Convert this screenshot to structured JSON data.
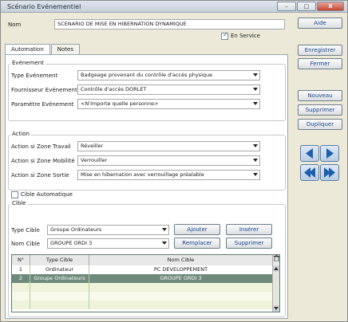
{
  "window": {
    "title": "Scénario Evénementiel",
    "controls": [
      "–",
      "□",
      "X"
    ]
  },
  "header": {
    "name_label": "Nom",
    "name_value": "SCENARIO DE MISE EN HIBERNATION DYNAMIQUE",
    "in_service_label": "En Service",
    "in_service_checked": true
  },
  "tabs": [
    {
      "label": "Automation",
      "active": true
    },
    {
      "label": "Notes",
      "active": false
    }
  ],
  "evenement": {
    "title": "Evénement",
    "fields": [
      {
        "label": "Type Evénement",
        "value": "Badgeage provenant du contrôle d'accès physique"
      },
      {
        "label": "Fournisseur Evénement",
        "value": "Contrôle d'accès DORLET"
      },
      {
        "label": "Paramètre Evénement",
        "value": "<N'importe quelle personne>"
      }
    ]
  },
  "action": {
    "title": "Action",
    "fields": [
      {
        "label": "Action si Zone Travail",
        "value": "Réveiller"
      },
      {
        "label": "Action si Zone Mobilité",
        "value": "Verrouiller"
      },
      {
        "label": "Action si Zone Sortie",
        "value": "Mise en hibernation avec verrouillage préalable"
      }
    ]
  },
  "cible": {
    "title": "Cible",
    "auto_label": "Cible Automatique",
    "auto_checked": false,
    "type_label": "Type Cible",
    "type_value": "Groupe Ordinateurs",
    "name_label": "Nom Cible",
    "name_value": "GROUPE ORDI 3",
    "buttons": {
      "ajouter": "Ajouter",
      "inserer": "Insérer",
      "remplacer": "Remplacer",
      "supprimer": "Supprimer"
    },
    "grid": {
      "headers": [
        "N°",
        "Type Cible",
        "Nom Cible"
      ],
      "rows": [
        {
          "n": "1",
          "type": "Ordinateur",
          "name": "PC DEVELOPPEMENT"
        },
        {
          "n": "2",
          "type": "Groupe Ordinateurs",
          "name": "GROUPE ORDI 3"
        }
      ]
    }
  },
  "side": {
    "aide": "Aide",
    "enregistrer": "Enregistrer",
    "fermer": "Fermer",
    "nouveau": "Nouveau",
    "supprimer": "Supprimer",
    "dupliquer": "Dupliquer"
  }
}
